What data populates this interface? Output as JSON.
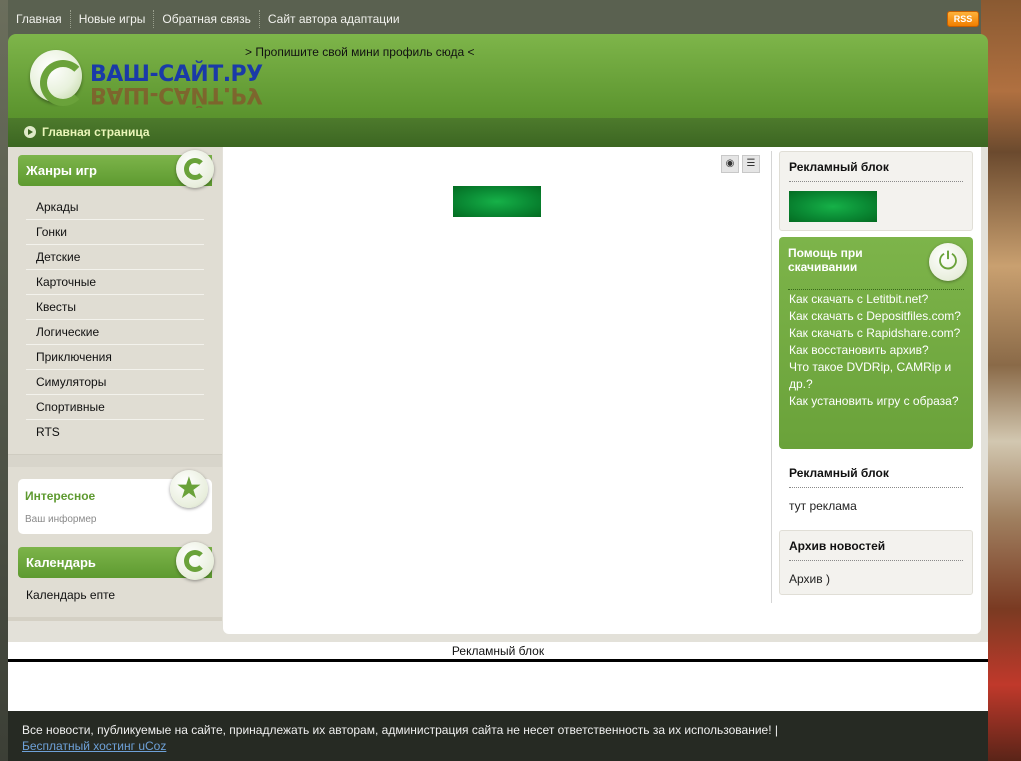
{
  "nav": {
    "items": [
      "Главная",
      "Новые игры",
      "Обратная связь",
      "Сайт автора адаптации"
    ],
    "rss_label": "RSS"
  },
  "header": {
    "logo_text": "ВАШ-САЙТ.РУ",
    "profile_message": "> Пропишите свой мини профиль сюда <"
  },
  "breadcrumb": {
    "label": "Главная страница"
  },
  "sidebar_left": {
    "genres_title": "Жанры игр",
    "genres": [
      "Аркады",
      "Гонки",
      "Детские",
      "Карточные",
      "Квесты",
      "Логические",
      "Приключения",
      "Симуляторы",
      "Спортивные",
      "RTS"
    ],
    "interesting_title": "Интересное",
    "interesting_sub": "Ваш информер",
    "calendar_title": "Календарь",
    "calendar_text": "Календарь епте"
  },
  "main": {
    "tool_view_icon": "eye-icon",
    "tool_list_icon": "list-icon"
  },
  "sidebar_right": {
    "ad1_title": "Рекламный блок",
    "help_title": "Помощь при скачивании",
    "help_links": [
      "Как скачать с Letitbit.net?",
      "Как скачать с Depositfiles.com?",
      "Как скачать с Rapidshare.com?",
      "Как восстановить архив?",
      "Что такое DVDRip, CAMRip и др.?",
      "Как установить игру с образа?"
    ],
    "ad2_title": "Рекламный блок",
    "ad2_text": "тут реклама",
    "archive_title": "Архив новостей",
    "archive_text": "Архив )"
  },
  "ad_strip": {
    "label": "Рекламный блок"
  },
  "footer": {
    "text": "Все новости, публикуемые на сайте, принадлежать их авторам, администрация сайта не несет ответственность за их использование! |",
    "link": "Бесплатный хостинг uCoz"
  },
  "colors": {
    "accent_green": "#6aa23a",
    "dark_green": "#3c6622",
    "banner_green": "#0a8a34",
    "footer_bg": "#262a23",
    "link_blue": "#6ea1d8"
  }
}
